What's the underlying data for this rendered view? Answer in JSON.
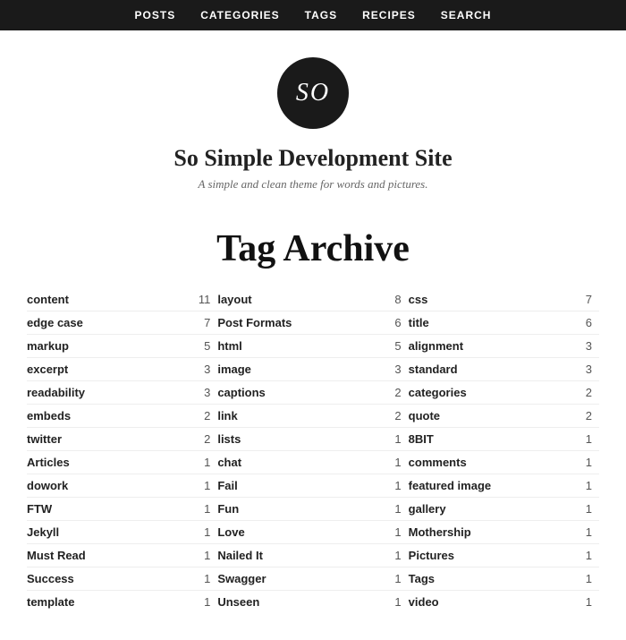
{
  "nav": {
    "items": [
      {
        "label": "POSTS",
        "href": "#"
      },
      {
        "label": "CATEGORIES",
        "href": "#"
      },
      {
        "label": "TAGS",
        "href": "#"
      },
      {
        "label": "RECIPES",
        "href": "#"
      },
      {
        "label": "SEARCH",
        "href": "#"
      }
    ]
  },
  "header": {
    "logo": "SO",
    "site_title": "So Simple Development Site",
    "site_tagline": "A simple and clean theme for words and pictures."
  },
  "page": {
    "title": "Tag Archive"
  },
  "columns": [
    {
      "tags": [
        {
          "name": "content",
          "count": "11"
        },
        {
          "name": "edge case",
          "count": "7"
        },
        {
          "name": "markup",
          "count": "5"
        },
        {
          "name": "excerpt",
          "count": "3"
        },
        {
          "name": "readability",
          "count": "3"
        },
        {
          "name": "embeds",
          "count": "2"
        },
        {
          "name": "twitter",
          "count": "2"
        },
        {
          "name": "Articles",
          "count": "1"
        },
        {
          "name": "dowork",
          "count": "1"
        },
        {
          "name": "FTW",
          "count": "1"
        },
        {
          "name": "Jekyll",
          "count": "1"
        },
        {
          "name": "Must Read",
          "count": "1"
        },
        {
          "name": "Success",
          "count": "1"
        },
        {
          "name": "template",
          "count": "1"
        }
      ]
    },
    {
      "tags": [
        {
          "name": "layout",
          "count": "8"
        },
        {
          "name": "Post Formats",
          "count": "6"
        },
        {
          "name": "html",
          "count": "5"
        },
        {
          "name": "image",
          "count": "3"
        },
        {
          "name": "captions",
          "count": "2"
        },
        {
          "name": "link",
          "count": "2"
        },
        {
          "name": "lists",
          "count": "1"
        },
        {
          "name": "chat",
          "count": "1"
        },
        {
          "name": "Fail",
          "count": "1"
        },
        {
          "name": "Fun",
          "count": "1"
        },
        {
          "name": "Love",
          "count": "1"
        },
        {
          "name": "Nailed It",
          "count": "1"
        },
        {
          "name": "Swagger",
          "count": "1"
        },
        {
          "name": "Unseen",
          "count": "1"
        }
      ]
    },
    {
      "tags": [
        {
          "name": "css",
          "count": "7"
        },
        {
          "name": "title",
          "count": "6"
        },
        {
          "name": "alignment",
          "count": "3"
        },
        {
          "name": "standard",
          "count": "3"
        },
        {
          "name": "categories",
          "count": "2"
        },
        {
          "name": "quote",
          "count": "2"
        },
        {
          "name": "8BIT",
          "count": "1"
        },
        {
          "name": "comments",
          "count": "1"
        },
        {
          "name": "featured image",
          "count": "1"
        },
        {
          "name": "gallery",
          "count": "1"
        },
        {
          "name": "Mothership",
          "count": "1"
        },
        {
          "name": "Pictures",
          "count": "1"
        },
        {
          "name": "Tags",
          "count": "1"
        },
        {
          "name": "video",
          "count": "1"
        }
      ]
    }
  ]
}
